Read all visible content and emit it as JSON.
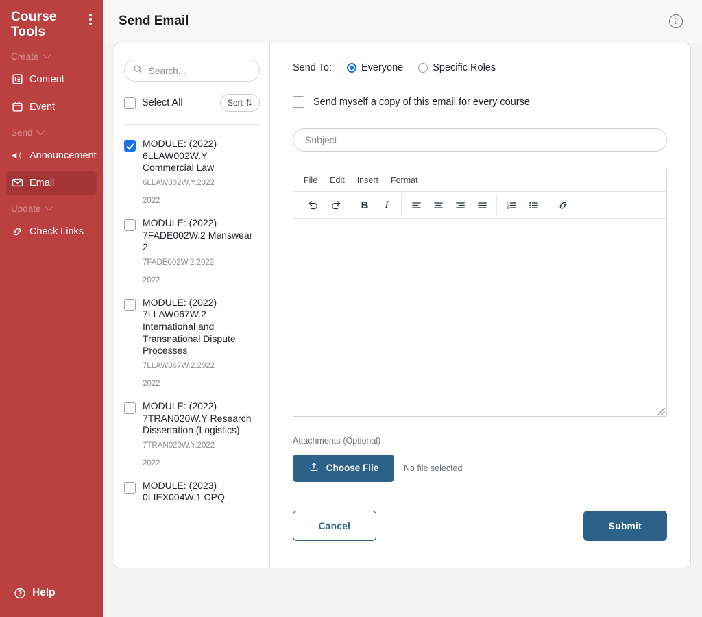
{
  "sidebar": {
    "title": "Course Tools",
    "menu_icon": "kebab-menu-icon",
    "groups": [
      {
        "label": "Create",
        "items": [
          {
            "label": "Content",
            "icon": "content-icon"
          },
          {
            "label": "Event",
            "icon": "calendar-icon"
          }
        ]
      },
      {
        "label": "Send",
        "items": [
          {
            "label": "Announcement",
            "icon": "megaphone-icon"
          },
          {
            "label": "Email",
            "icon": "envelope-icon",
            "active": true
          }
        ]
      },
      {
        "label": "Update",
        "items": [
          {
            "label": "Check Links",
            "icon": "link-icon"
          }
        ]
      }
    ],
    "help_label": "Help",
    "bg_color": "#bb4141",
    "active_color": "#a53535",
    "muted_color": "#d98e8e"
  },
  "header": {
    "title": "Send Email",
    "help_icon": "question-circle-icon"
  },
  "list_pane": {
    "search": {
      "placeholder": "Search...",
      "value": "",
      "icon": "search-icon"
    },
    "select_all_label": "Select All",
    "select_all_checked": false,
    "sort_label": "Sort",
    "sort_icon": "sort-arrows-icon",
    "modules": [
      {
        "name": "MODULE: (2022) 6LLAW002W.Y Commercial Law",
        "code": "6LLAW002W.Y.2022",
        "year": "2022",
        "checked": true
      },
      {
        "name": "MODULE: (2022) 7FADE002W.2 Menswear 2",
        "code": "7FADE002W.2.2022",
        "year": "2022",
        "checked": false
      },
      {
        "name": "MODULE: (2022) 7LLAW067W.2 International and Transnational Dispute Processes",
        "code": "7LLAW067W.2.2022",
        "year": "2022",
        "checked": false
      },
      {
        "name": "MODULE: (2022) 7TRAN020W.Y Research Dissertation (Logistics)",
        "code": "7TRAN020W.Y.2022",
        "year": "2022",
        "checked": false
      },
      {
        "name": "MODULE: (2023) 0LIEX004W.1 CPQ",
        "code": "",
        "year": "",
        "checked": false
      }
    ]
  },
  "form": {
    "send_to_label": "Send To:",
    "send_to_options": [
      {
        "label": "Everyone",
        "selected": true
      },
      {
        "label": "Specific Roles",
        "selected": false
      }
    ],
    "copy_checkbox_label": "Send myself a copy of this email for every course",
    "copy_checkbox_checked": false,
    "subject": {
      "placeholder": "Subject",
      "value": ""
    },
    "editor": {
      "menu": [
        "File",
        "Edit",
        "Insert",
        "Format"
      ],
      "tools": [
        {
          "name": "undo-icon",
          "label": "Undo"
        },
        {
          "name": "redo-icon",
          "label": "Redo"
        },
        {
          "name": "bold-icon",
          "label": "B"
        },
        {
          "name": "italic-icon",
          "label": "I"
        },
        {
          "name": "align-left-icon",
          "label": "Align left"
        },
        {
          "name": "align-center-icon",
          "label": "Align center"
        },
        {
          "name": "align-right-icon",
          "label": "Align right"
        },
        {
          "name": "align-justify-icon",
          "label": "Justify"
        },
        {
          "name": "numbered-list-icon",
          "label": "Numbered list"
        },
        {
          "name": "bullet-list-icon",
          "label": "Bullet list"
        },
        {
          "name": "link-icon",
          "label": "Insert link"
        }
      ],
      "body": ""
    },
    "attachments_label": "Attachments",
    "attachments_optional": "(Optional)",
    "choose_file_label": "Choose File",
    "choose_file_icon": "upload-icon",
    "no_file_text": "No file selected",
    "cancel_label": "Cancel",
    "submit_label": "Submit",
    "accent_color": "#2c6189",
    "radio_color": "#1a73e8"
  }
}
